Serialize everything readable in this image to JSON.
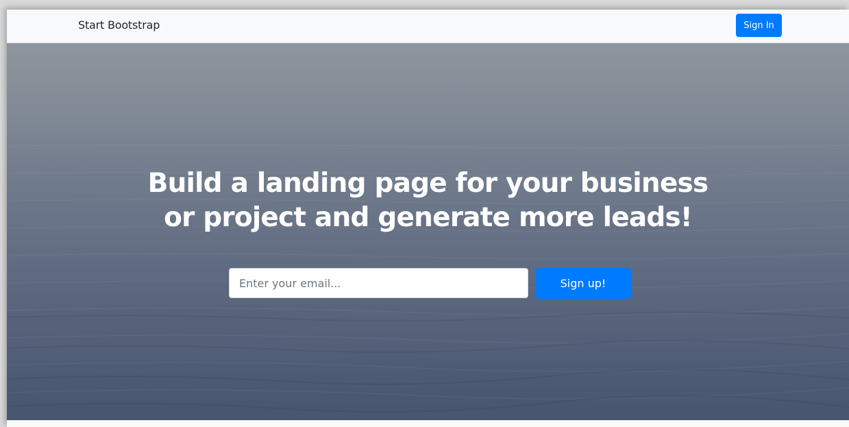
{
  "navbar": {
    "brand": "Start Bootstrap",
    "signin_label": "Sign In"
  },
  "hero": {
    "heading_line1": "Build a landing page for your business",
    "heading_line2": "or project and generate more leads!",
    "email_placeholder": "Enter your email...",
    "email_value": "",
    "signup_label": "Sign up!"
  },
  "colors": {
    "primary": "#007bff",
    "navbar_bg": "#f8f9fa",
    "hero_top": "#8d959e",
    "hero_bottom": "#47556e"
  }
}
